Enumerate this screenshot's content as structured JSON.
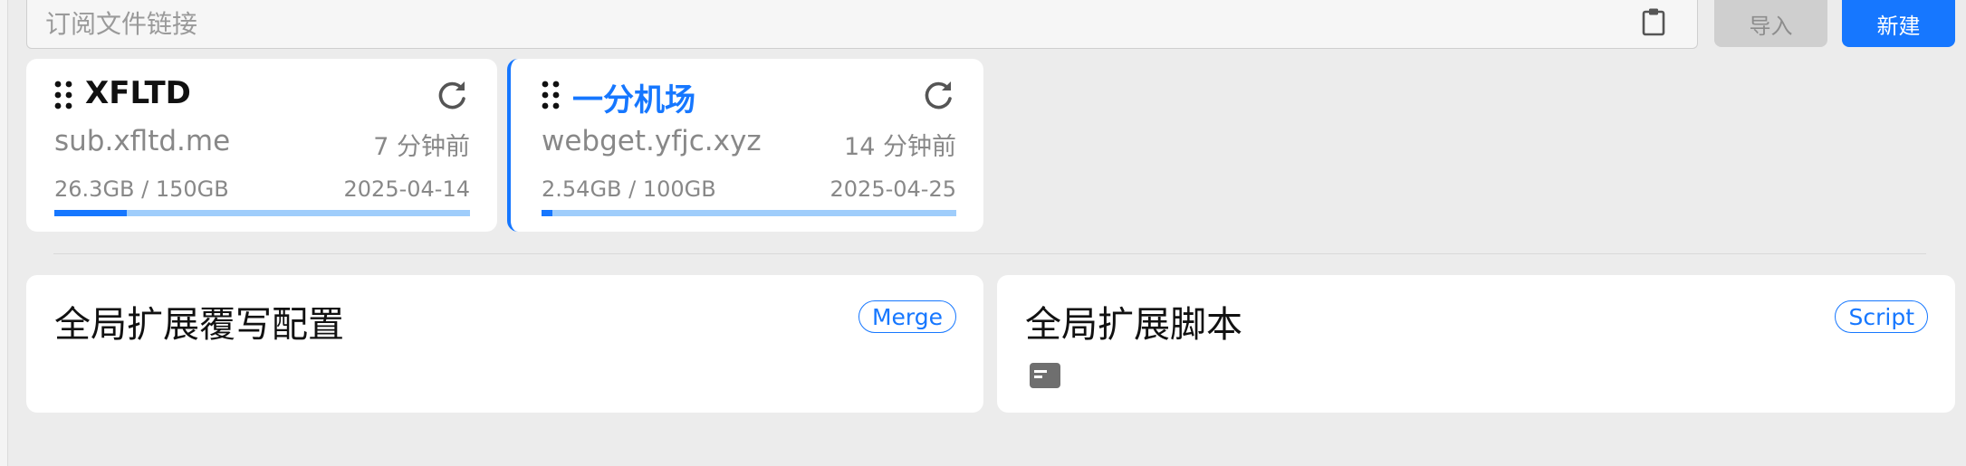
{
  "subscription_bar": {
    "url_placeholder": "订阅文件链接",
    "url_value": "",
    "clipboard_icon": "clipboard-icon",
    "import_label": "导入",
    "new_label": "新建"
  },
  "profiles": [
    {
      "name": "XFLTD",
      "host": "sub.xfltd.me",
      "updated": "7 分钟前",
      "usage": "26.3GB / 150GB",
      "expire": "2025-04-14",
      "usage_fraction": 0.175,
      "selected": false
    },
    {
      "name": "一分机场",
      "host": "webget.yfjc.xyz",
      "updated": "14 分钟前",
      "usage": "2.54GB / 100GB",
      "expire": "2025-04-25",
      "usage_fraction": 0.0254,
      "selected": true
    }
  ],
  "global_extensions": {
    "merge": {
      "title": "全局扩展覆写配置",
      "badge": "Merge"
    },
    "script": {
      "title": "全局扩展脚本",
      "badge": "Script",
      "icon": "terminal-icon"
    }
  },
  "colors": {
    "accent": "#1677ff",
    "progress_track": "#9fcdfb",
    "background": "#ececec"
  }
}
